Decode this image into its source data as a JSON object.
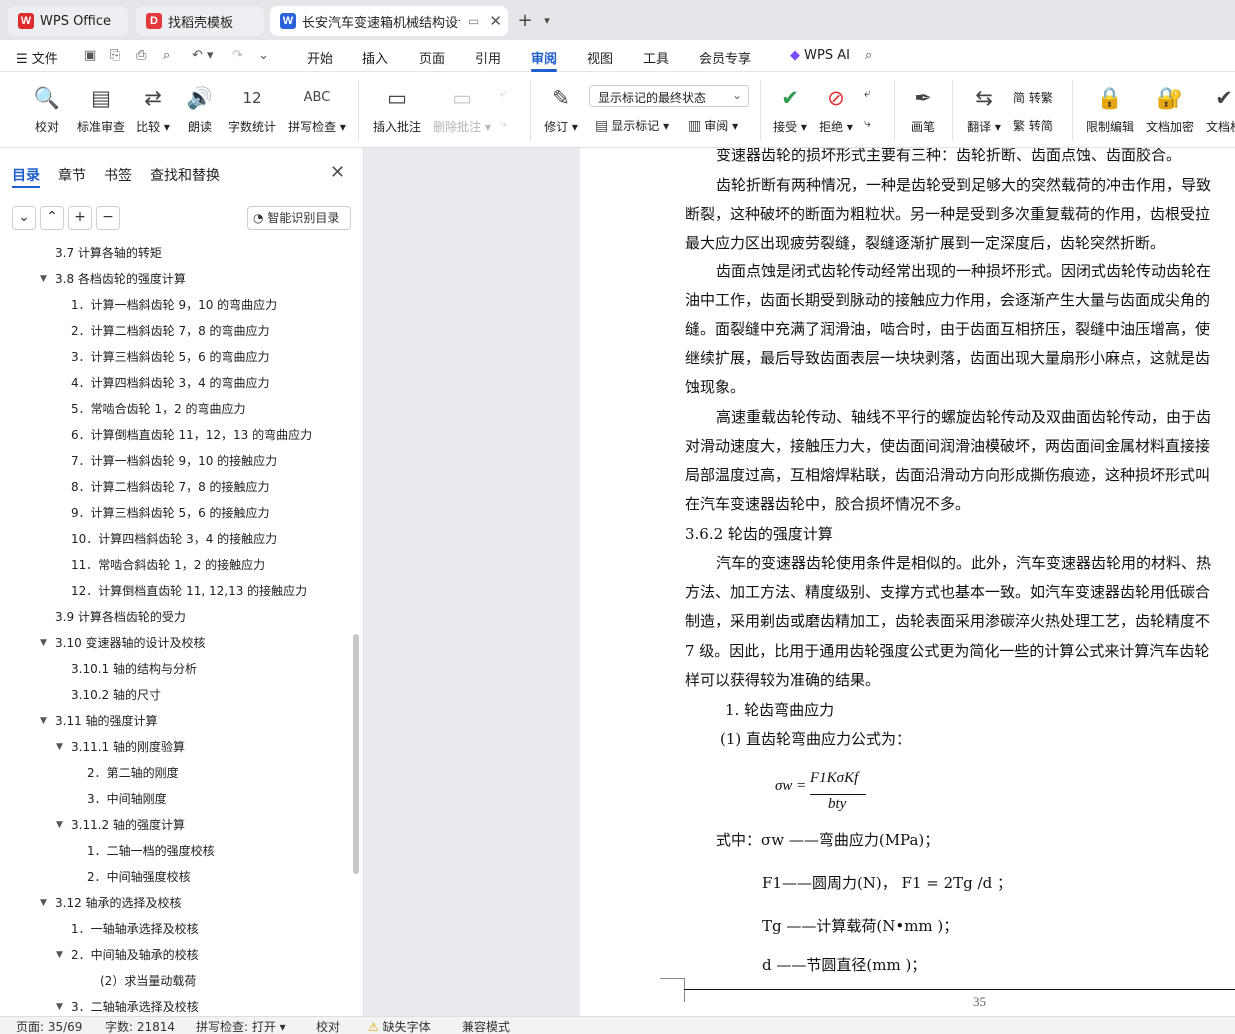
{
  "tabs": [
    {
      "label": "WPS Office",
      "icon": "wps-logo-icon"
    },
    {
      "label": "找稻壳模板",
      "icon": "docer-icon"
    },
    {
      "label": "长安汽车变速箱机械结构设计",
      "icon": "writer-doc-icon"
    }
  ],
  "menu": {
    "file": "文件",
    "items": [
      "开始",
      "插入",
      "页面",
      "引用",
      "审阅",
      "视图",
      "工具",
      "会员专享"
    ],
    "active": "审阅",
    "ai": "WPS AI"
  },
  "ribbon": {
    "proofread": "校对",
    "standard_review": "标准审查",
    "compare": "比较",
    "read_aloud": "朗读",
    "word_count": "字数统计",
    "word_count_glyph": "12",
    "spell_check": "拼写检查",
    "spell_glyph": "ABC",
    "insert_comment": "插入批注",
    "delete_comment": "删除批注",
    "revise": "修订",
    "markup_state": "显示标记的最终状态",
    "show_markup": "显示标记",
    "review": "审阅",
    "accept": "接受",
    "reject": "拒绝",
    "pen": "画笔",
    "translate": "翻译",
    "to_traditional": "简 转繁",
    "to_simplified": "繁 转简",
    "restrict_edit": "限制编辑",
    "encrypt": "文档加密",
    "doc_permission": "文档权"
  },
  "nav": {
    "tabs": [
      "目录",
      "章节",
      "书签",
      "查找和替换"
    ],
    "smart_button": "智能识别目录",
    "toc": [
      {
        "text": "3.7 计算各轴的转矩",
        "level": 1,
        "arrow": ""
      },
      {
        "text": "3.8 各档齿轮的强度计算",
        "level": 1,
        "arrow": "▼"
      },
      {
        "text": "1．计算一档斜齿轮 9，10 的弯曲应力",
        "level": 2,
        "arrow": ""
      },
      {
        "text": "2．计算二档斜齿轮 7，8 的弯曲应力",
        "level": 2,
        "arrow": ""
      },
      {
        "text": "3．计算三档斜齿轮 5，6 的弯曲应力",
        "level": 2,
        "arrow": ""
      },
      {
        "text": "4．计算四档斜齿轮 3，4 的弯曲应力",
        "level": 2,
        "arrow": ""
      },
      {
        "text": "5．常啮合齿轮 1，2 的弯曲应力",
        "level": 2,
        "arrow": ""
      },
      {
        "text": "6．计算倒档直齿轮 11，12，13 的弯曲应力",
        "level": 2,
        "arrow": ""
      },
      {
        "text": "7．计算一档斜齿轮 9，10 的接触应力",
        "level": 2,
        "arrow": ""
      },
      {
        "text": "8．计算二档斜齿轮 7，8 的接触应力",
        "level": 2,
        "arrow": ""
      },
      {
        "text": "9．计算三档斜齿轮 5，6 的接触应力",
        "level": 2,
        "arrow": ""
      },
      {
        "text": "10．计算四档斜齿轮 3，4 的接触应力",
        "level": 2,
        "arrow": ""
      },
      {
        "text": "11．常啮合斜齿轮 1，2 的接触应力",
        "level": 2,
        "arrow": ""
      },
      {
        "text": "12．计算倒档直齿轮 11, 12,13 的接触应力",
        "level": 2,
        "arrow": ""
      },
      {
        "text": "3.9 计算各档齿轮的受力",
        "level": 1,
        "arrow": ""
      },
      {
        "text": "3.10 变速器轴的设计及校核",
        "level": 1,
        "arrow": "▼"
      },
      {
        "text": "3.10.1 轴的结构与分析",
        "level": 2,
        "arrow": ""
      },
      {
        "text": "3.10.2 轴的尺寸",
        "level": 2,
        "arrow": ""
      },
      {
        "text": "3.11 轴的强度计算",
        "level": 1,
        "arrow": "▼"
      },
      {
        "text": "3.11.1 轴的刚度验算",
        "level": 2,
        "arrow": "▼"
      },
      {
        "text": "2．第二轴的刚度",
        "level": 3,
        "arrow": ""
      },
      {
        "text": "3．中间轴刚度",
        "level": 3,
        "arrow": ""
      },
      {
        "text": "3.11.2 轴的强度计算",
        "level": 2,
        "arrow": "▼"
      },
      {
        "text": "1．二轴一档的强度校核",
        "level": 3,
        "arrow": ""
      },
      {
        "text": "2．中间轴强度校核",
        "level": 3,
        "arrow": ""
      },
      {
        "text": "3.12 轴承的选择及校核",
        "level": 1,
        "arrow": "▼"
      },
      {
        "text": "1．一轴轴承选择及校核",
        "level": 2,
        "arrow": ""
      },
      {
        "text": "2．中间轴及轴承的校核",
        "level": 2,
        "arrow": "▼"
      },
      {
        "text": "(2）求当量动载荷",
        "level": 4,
        "arrow": ""
      },
      {
        "text": "3．二轴轴承选择及校核",
        "level": 2,
        "arrow": "▼"
      }
    ]
  },
  "document": {
    "lines": [
      "变速器齿轮的损坏形式主要有三种：齿轮折断、齿面点蚀、齿面胶合。",
      "齿轮折断有两种情况，一种是齿轮受到足够大的突然载荷的冲击作用，导致",
      "断裂，这种破坏的断面为粗粒状。另一种是受到多次重复载荷的作用，齿根受拉",
      "最大应力区出现疲劳裂缝，裂缝逐渐扩展到一定深度后，齿轮突然折断。",
      "齿面点蚀是闭式齿轮传动经常出现的一种损坏形式。因闭式齿轮传动齿轮在",
      "油中工作，齿面长期受到脉动的接触应力作用，会逐渐产生大量与齿面成尖角的",
      "缝。面裂缝中充满了润滑油，啮合时，由于齿面互相挤压，裂缝中油压增高，使",
      "继续扩展，最后导致齿面表层一块块剥落，齿面出现大量扇形小麻点，这就是齿",
      "蚀现象。",
      "高速重载齿轮传动、轴线不平行的螺旋齿轮传动及双曲面齿轮传动，由于齿",
      "对滑动速度大，接触压力大，使齿面间润滑油模破坏，两齿面间金属材料直接接",
      "局部温度过高，互相熔焊粘联，齿面沿滑动方向形成撕伤痕迹，这种损坏形式叫",
      "在汽车变速器齿轮中，胶合损坏情况不多。",
      "3.6.2 轮齿的强度计算",
      "汽车的变速器齿轮使用条件是相似的。此外，汽车变速器齿轮用的材料、热",
      "方法、加工方法、精度级别、支撑方式也基本一致。如汽车变速器齿轮用低碳合",
      "制造，采用剃齿或磨齿精加工，齿轮表面采用渗碳淬火热处理工艺，齿轮精度不",
      "7 级。因此，比用于通用齿轮强度公式更为简化一些的计算公式来计算汽车齿轮",
      "样可以获得较为准确的结果。",
      "1.  轮齿弯曲应力",
      "(1) 直齿轮弯曲应力公式为：",
      "式中：σw ——弯曲应力(MPa)；",
      "F1——圆周力(N)，  F1 = 2Tg /d ；",
      "Tg ——计算载荷(N•mm )；",
      "d ——节圆直径(mm )；"
    ],
    "formula_lhs": "σw =",
    "formula_num": "F1KσKf",
    "formula_den": "bty",
    "page_number": "35"
  },
  "status": {
    "page": "页面: 35/69",
    "words": "字数: 21814",
    "spell": "拼写检查: 打开",
    "proof": "校对",
    "missing_font": "缺失字体",
    "compat": "兼容模式"
  },
  "colors": {
    "accent": "#1f5ecc",
    "wps_red": "#e02b2b",
    "docer_red": "#e4393c",
    "writer_blue": "#2b62d9"
  }
}
